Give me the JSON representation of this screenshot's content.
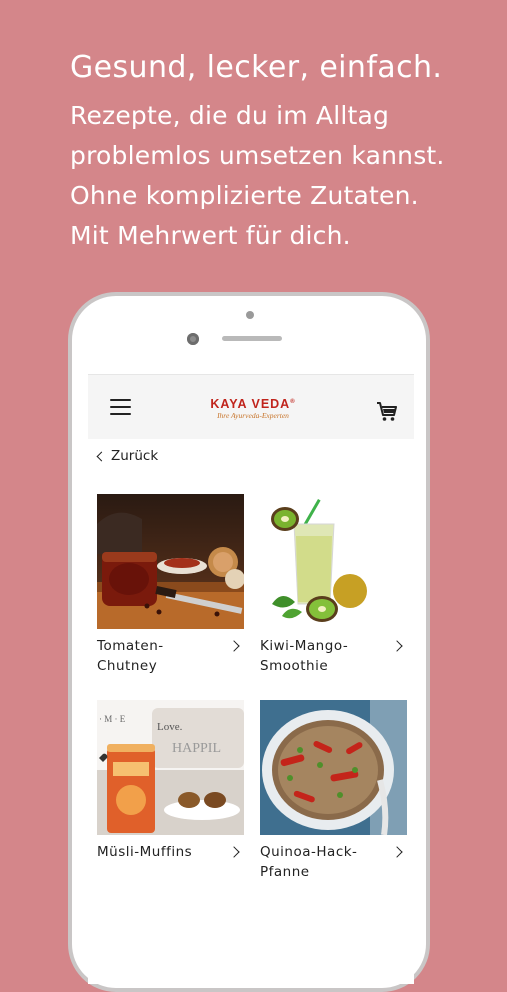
{
  "promo": {
    "headline": "Gesund, lecker, einfach.",
    "lines": [
      "Rezepte, die du im Alltag",
      "problemlos umsetzen kannst.",
      "Ohne komplizierte Zutaten.",
      "Mit Mehrwert für dich."
    ]
  },
  "app": {
    "brand": "KAYA VEDA",
    "brand_mark": "®",
    "tagline": "Ihre Ayurveda-Experten",
    "back_label": "Zurück",
    "icons": {
      "menu": "hamburger-menu-icon",
      "cart": "shopping-cart-icon",
      "back": "chevron-left-icon"
    },
    "recipes": [
      {
        "line1": "Tomaten-",
        "line2": "Chutney"
      },
      {
        "line1": "Kiwi-Mango-",
        "line2": "Smoothie"
      },
      {
        "line1": "Müsli-Muffins",
        "line2": ""
      },
      {
        "line1": "Quinoa-Hack-",
        "line2": "Pfanne"
      }
    ]
  },
  "colors": {
    "background": "#d4868a",
    "brand_red": "#c0241c",
    "tagline_orange": "#c7742a"
  }
}
